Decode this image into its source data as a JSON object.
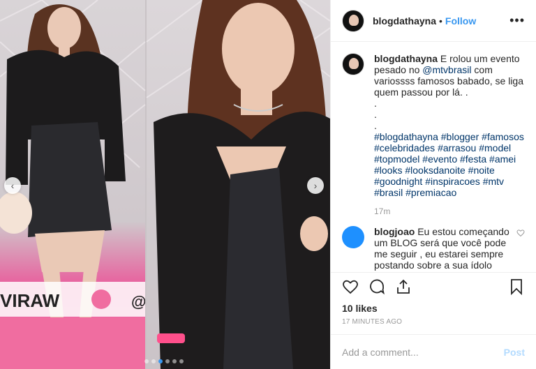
{
  "post": {
    "username": "blogdathayna",
    "follow_label": "Follow",
    "separator": "•",
    "more_label": "•••",
    "colors": {
      "follow": "#3897f0",
      "post_disabled": "#b3dbff",
      "meta": "#999999"
    },
    "caption": {
      "username": "blogdathayna",
      "text_before": "E rolou um evento pesado no",
      "mention": "@mtvbrasil",
      "text_after": "com variossss famosos babado, se liga quem passou por lá. .",
      "dots": [
        ".",
        ".",
        "."
      ],
      "hashtags": [
        "#blogdathayna",
        "#blogger",
        "#famosos",
        "#celebridades",
        "#arrasou",
        "#model",
        "#topmodel",
        "#evento",
        "#festa",
        "#amei",
        "#looks",
        "#looksdanoite",
        "#noite",
        "#goodnight",
        "#inspiracoes",
        "#mtv",
        "#brasil",
        "#premiacao"
      ],
      "age": "17m"
    },
    "comment": {
      "username": "blogjoao",
      "text": "Eu estou começando um BLOG será que você pode me seguir , eu estarei sempre postando sobre a sua ídolo"
    },
    "likes": "10 likes",
    "timestamp": "17 MINUTES AGO",
    "add_comment_placeholder": "Add a comment...",
    "post_label": "Post"
  },
  "media": {
    "prev_arrow": "‹",
    "next_arrow": "›",
    "slide_count": 6,
    "active_slide": 3,
    "backdrop_text": "VIRAW",
    "backdrop_text_2": "@"
  },
  "icons": [
    "heart-icon",
    "comment-icon",
    "share-icon",
    "bookmark-icon",
    "more-icon"
  ]
}
